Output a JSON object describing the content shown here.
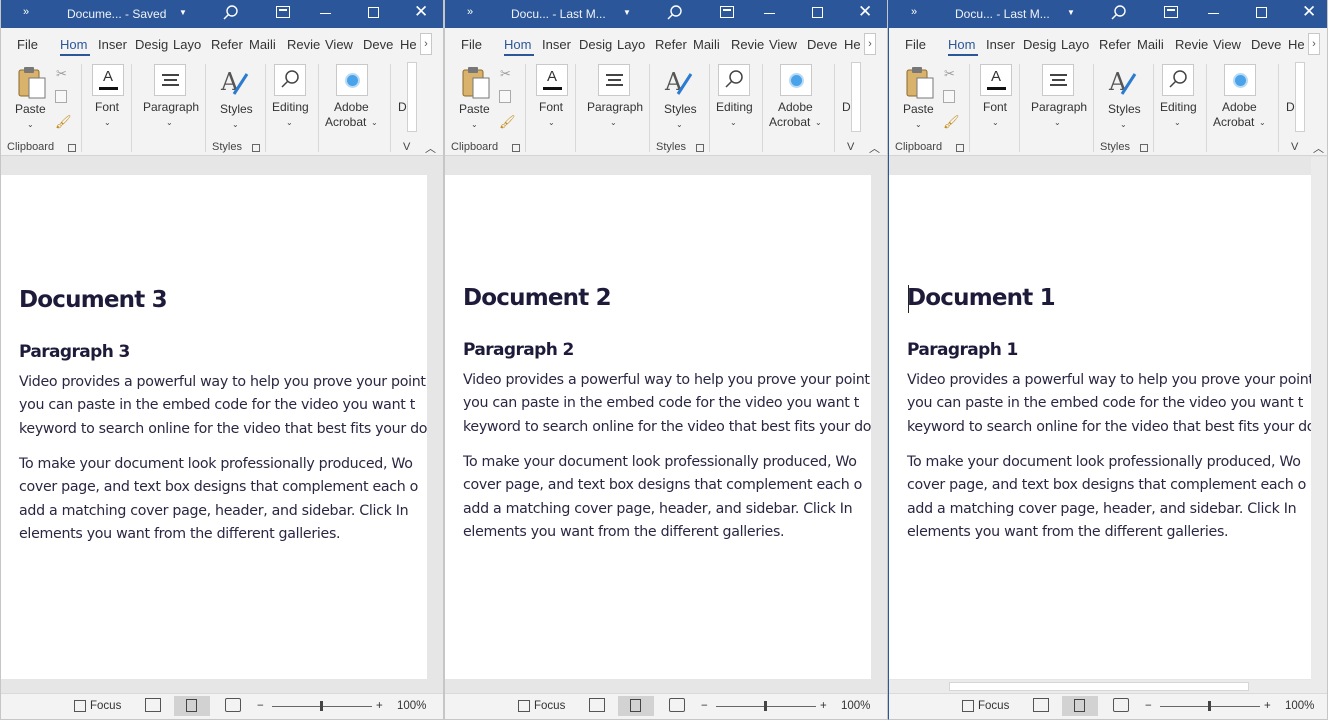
{
  "colors": {
    "titlebar": "#2b579a",
    "accent": "#2b579a",
    "doc_text": "#1e1b3a"
  },
  "ribbon": {
    "tabs": [
      "File",
      "Hom",
      "Inser",
      "Desig",
      "Layo",
      "Refer",
      "Maili",
      "Revie",
      "View",
      "Deve",
      "He"
    ],
    "buttons": {
      "paste": "Paste",
      "font": "Font",
      "paragraph": "Paragraph",
      "styles": "Styles",
      "editing": "Editing",
      "adobe_line1": "Adobe",
      "adobe_line2": "Acrobat",
      "dictate": "D",
      "voice": "V"
    },
    "groups": {
      "clipboard": "Clipboard",
      "styles": "Styles"
    },
    "icons": [
      "quick-access-more-icon",
      "search-icon",
      "ribbon-display-options-icon",
      "minimize-icon",
      "maximize-icon",
      "close-icon",
      "paste-icon",
      "cut-icon",
      "copy-icon",
      "format-painter-icon",
      "font-icon",
      "paragraph-icon",
      "styles-icon",
      "editing-icon",
      "adobe-acrobat-icon",
      "dialog-launcher-icon",
      "collapse-ribbon-icon",
      "focus-icon",
      "read-mode-icon",
      "print-layout-icon",
      "web-layout-icon"
    ]
  },
  "body": {
    "p1": {
      "line1": "Video provides a powerful way to help you prove your point.",
      "line2": "you can paste in the embed code for the video you want t",
      "line3": "keyword to search online for the video that best fits your do"
    },
    "p2": {
      "line1": "To make your document look professionally produced, Wo",
      "line2": "cover page, and text box designs that complement each o",
      "line3": "add a matching cover page, header, and sidebar. Click In",
      "line4": "elements you want from the different galleries."
    }
  },
  "status": {
    "focus": "Focus",
    "zoom_minus": "−",
    "zoom_plus": "+",
    "zoom": "100%"
  },
  "windows": [
    {
      "title": "Docume...  -  Saved",
      "heading": "Document 3",
      "paragraph": "Paragraph 3",
      "active": false
    },
    {
      "title": "Docu...  -  Last M...",
      "heading": "Document 2",
      "paragraph": "Paragraph 2",
      "active": false
    },
    {
      "title": "Docu...  -  Last M...",
      "heading": "Document 1",
      "paragraph": "Paragraph 1",
      "active": true
    }
  ]
}
